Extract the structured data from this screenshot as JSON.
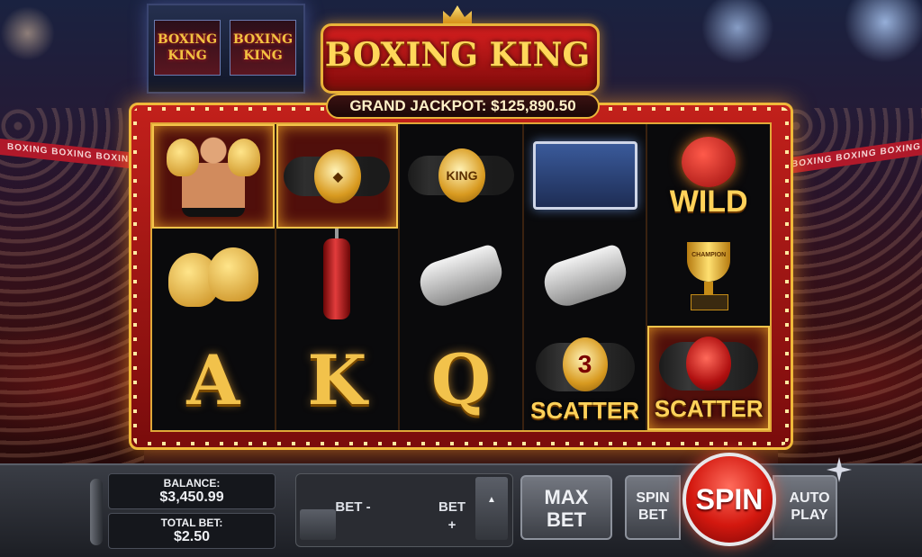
{
  "game": {
    "title": "BOXING KING",
    "jackpot": "GRAND JACKPOT: $125,890.50",
    "jumbotron": [
      "BOXING KING",
      "BOXING KING"
    ],
    "banners": [
      "BOXING  BOXING  BOXING",
      "BOXING  BOXING  BOXING"
    ]
  },
  "reels": [
    [
      {
        "symbol": "boxer",
        "label": "",
        "win": true
      },
      {
        "symbol": "gold-gloves",
        "label": "",
        "win": false
      },
      {
        "symbol": "letter",
        "label": "A",
        "win": false
      }
    ],
    [
      {
        "symbol": "diamond-belt",
        "label": "",
        "win": true
      },
      {
        "symbol": "punching-bag",
        "label": "",
        "win": false
      },
      {
        "symbol": "letter",
        "label": "K",
        "win": false
      }
    ],
    [
      {
        "symbol": "king-belt",
        "label": "KING",
        "win": false
      },
      {
        "symbol": "whistle",
        "label": "",
        "win": false
      },
      {
        "symbol": "letter",
        "label": "Q",
        "win": false
      }
    ],
    [
      {
        "symbol": "boxing-ring",
        "label": "",
        "win": false
      },
      {
        "symbol": "whistle",
        "label": "",
        "win": false
      },
      {
        "symbol": "scatter-belt",
        "label": "SCATTER",
        "badge": "3",
        "win": false
      }
    ],
    [
      {
        "symbol": "wild",
        "label": "WILD",
        "win": false
      },
      {
        "symbol": "trophy",
        "label": "",
        "badge": "CHAMPION",
        "win": false
      },
      {
        "symbol": "scatter-glove",
        "label": "SCATTER",
        "win": true
      }
    ]
  ],
  "controls": {
    "balance_label": "BALANCE:",
    "balance_value": "$3,450.99",
    "total_bet_label": "TOTAL BET:",
    "total_bet_value": "$2.50",
    "bet_minus": "BET -",
    "bet_plus": "BET +",
    "max_bet": "MAX BET",
    "spin_bet": "SPIN BET",
    "spin": "SPIN",
    "auto_play": "AUTO PLAY"
  },
  "colors": {
    "accent_gold": "#f2c24b",
    "frame_red": "#c2201b",
    "spin_red": "#d3180f"
  }
}
